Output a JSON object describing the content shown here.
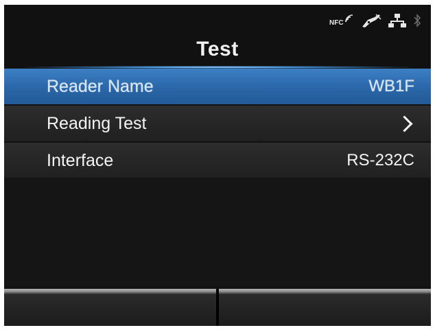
{
  "status_bar": {
    "nfc_label": "NFC",
    "icons": [
      "nfc-icon",
      "barcode-reader-icon",
      "network-icon",
      "bluetooth-icon"
    ]
  },
  "screen": {
    "title": "Test"
  },
  "menu": {
    "items": [
      {
        "label": "Reader Name",
        "value": "WB1F",
        "selected": true
      },
      {
        "label": "Reading Test",
        "value": "",
        "has_submenu": true
      },
      {
        "label": "Interface",
        "value": "RS-232C"
      }
    ]
  },
  "colors": {
    "background": "#111111",
    "selected_row": "#2a66a8",
    "row": "#262626",
    "text": "#f4f4f4"
  }
}
